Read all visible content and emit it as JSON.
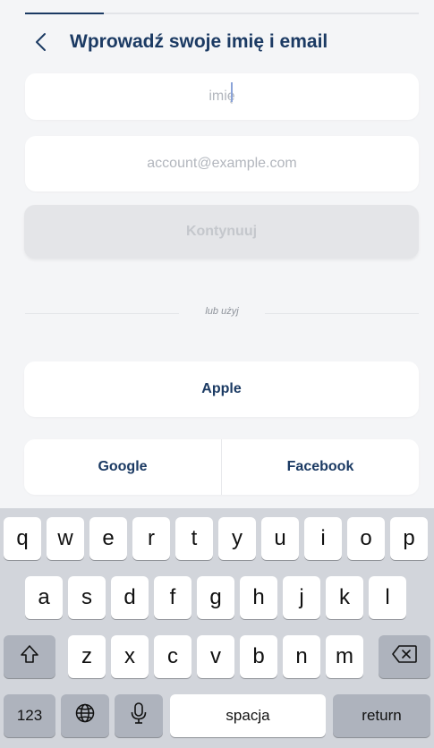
{
  "progress": {
    "fraction": 0.2
  },
  "header": {
    "back_icon": "chevron-left-icon",
    "title": "Wprowadź swoje imię i email"
  },
  "form": {
    "name_placeholder": "imię",
    "name_value": "",
    "email_placeholder": "account@example.com",
    "email_value": "",
    "continue_label": "Kontynuuj"
  },
  "divider": {
    "label": "lub użyj"
  },
  "social": {
    "apple_label": "Apple",
    "google_label": "Google",
    "facebook_label": "Facebook"
  },
  "keyboard": {
    "row1": [
      "q",
      "w",
      "e",
      "r",
      "t",
      "y",
      "u",
      "i",
      "o",
      "p"
    ],
    "row2": [
      "a",
      "s",
      "d",
      "f",
      "g",
      "h",
      "j",
      "k",
      "l"
    ],
    "row3": [
      "z",
      "x",
      "c",
      "v",
      "b",
      "n",
      "m"
    ],
    "numbers_label": "123",
    "space_label": "spacja",
    "return_label": "return",
    "shift_icon": "shift-icon",
    "delete_icon": "backspace-icon",
    "globe_icon": "globe-icon",
    "mic_icon": "microphone-icon"
  },
  "colors": {
    "accent": "#1b3a63",
    "background": "#f4f5f7",
    "disabled_button": "#e4e5e8",
    "keyboard_background": "#d2d5db"
  }
}
